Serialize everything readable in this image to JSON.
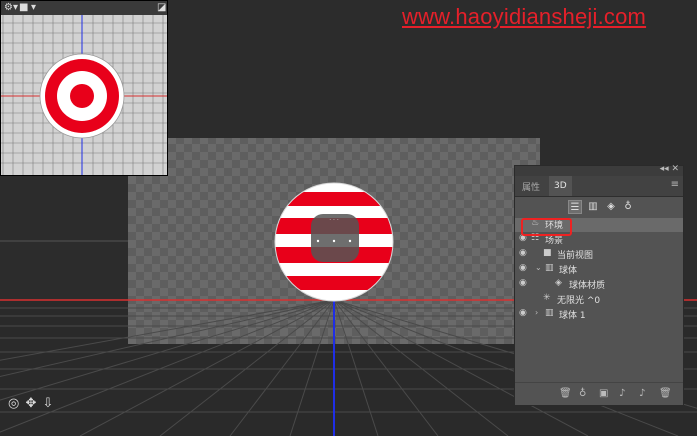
{
  "watermark": "www.haoyidiansheji.com",
  "mini_view": {
    "camera_label": "▾",
    "close_label": "◪"
  },
  "panel": {
    "collapse_label": "◂◂ ✕",
    "tabs": [
      {
        "label": "属性",
        "active": false
      },
      {
        "label": "3D",
        "active": true
      }
    ],
    "menu_label": "≡",
    "filters": [
      "scene-filter-icon",
      "mesh-filter-icon",
      "material-filter-icon",
      "light-filter-icon"
    ],
    "layers": [
      {
        "label": "环境",
        "icon": "environment-icon",
        "eye": true,
        "caret": "",
        "indent": 0
      },
      {
        "label": "场景",
        "icon": "scene-icon",
        "eye": true,
        "caret": "",
        "indent": 0
      },
      {
        "label": "当前视图",
        "icon": "camera-icon",
        "eye": true,
        "caret": "",
        "indent": 1
      },
      {
        "label": "球体",
        "icon": "mesh-icon",
        "eye": true,
        "caret": "⌄",
        "indent": 1
      },
      {
        "label": "球体材质",
        "icon": "material-icon",
        "eye": true,
        "caret": "",
        "indent": 2
      },
      {
        "label": "无限光 ^0",
        "icon": "infinite-light-icon",
        "eye": false,
        "caret": "",
        "indent": 1
      },
      {
        "label": "球体 1",
        "icon": "mesh-icon",
        "eye": true,
        "caret": "›",
        "indent": 1
      }
    ],
    "bottom_icons": [
      "delete-icon",
      "light-bulb-icon",
      "new-mesh-icon",
      "new-light-icon",
      "move-icon",
      "trash-icon"
    ]
  },
  "nav": {
    "orbit": "◎",
    "pan": "✥",
    "dolly": "⇩"
  },
  "colors": {
    "target_red": "#e8001a",
    "grid_red": "#d83030",
    "axis_blue": "#1f2ee6"
  }
}
